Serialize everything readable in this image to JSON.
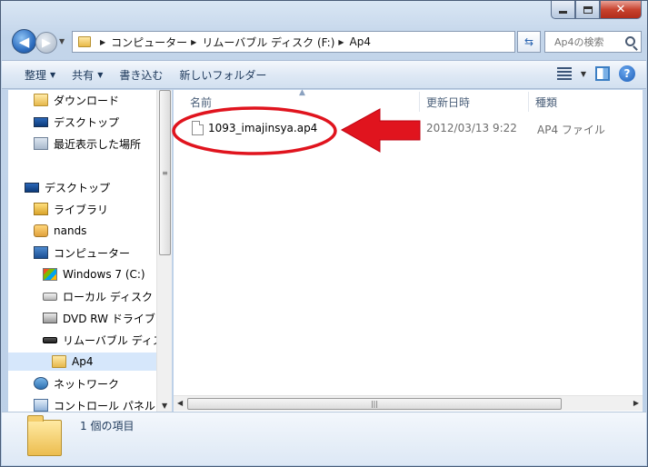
{
  "window": {
    "caption": {
      "minimize_icon": "minimize-icon",
      "maximize_icon": "maximize-icon",
      "close_glyph": "✕"
    }
  },
  "nav": {
    "back_glyph": "◀",
    "forward_glyph": "▶",
    "history_glyph": "▼"
  },
  "address": {
    "crumbs": [
      "コンピューター",
      "リムーバブル ディスク (F:)",
      "Ap4"
    ],
    "separator": "▶",
    "refresh_glyph": "⇆"
  },
  "search": {
    "placeholder": "Ap4の検索"
  },
  "toolbar": {
    "organize": "整理",
    "share": "共有",
    "burn": "書き込む",
    "new_folder": "新しいフォルダー",
    "caret": "▼",
    "help": "?"
  },
  "navpane": {
    "items": [
      {
        "label": "ダウンロード",
        "icon": "download-folder-icon"
      },
      {
        "label": "デスクトップ",
        "icon": "desktop-icon"
      },
      {
        "label": "最近表示した場所",
        "icon": "recent-places-icon"
      },
      {
        "label": "デスクトップ",
        "icon": "desktop-icon"
      },
      {
        "label": "ライブラリ",
        "icon": "library-icon"
      },
      {
        "label": "nands",
        "icon": "user-folder-icon"
      },
      {
        "label": "コンピューター",
        "icon": "computer-icon"
      },
      {
        "label": "Windows 7 (C:)",
        "icon": "windows-drive-icon"
      },
      {
        "label": "ローカル ディスク",
        "icon": "local-disk-icon"
      },
      {
        "label": "DVD RW ドライブ",
        "icon": "dvd-drive-icon"
      },
      {
        "label": "リムーバブル ディス",
        "icon": "removable-disk-icon"
      },
      {
        "label": "Ap4",
        "icon": "folder-icon"
      },
      {
        "label": "ネットワーク",
        "icon": "network-icon"
      },
      {
        "label": "コントロール パネル",
        "icon": "control-panel-icon"
      }
    ]
  },
  "content": {
    "columns": [
      "名前",
      "更新日時",
      "種類"
    ],
    "files": [
      {
        "name": "1093_imajinsya.ap4",
        "modified": "2012/03/13 9:22",
        "type": "AP4 ファイル"
      }
    ]
  },
  "status": {
    "item_count": "1 個の項目"
  },
  "annotation": {
    "circle_color": "#e0141e",
    "arrow_color": "#e0141e"
  }
}
